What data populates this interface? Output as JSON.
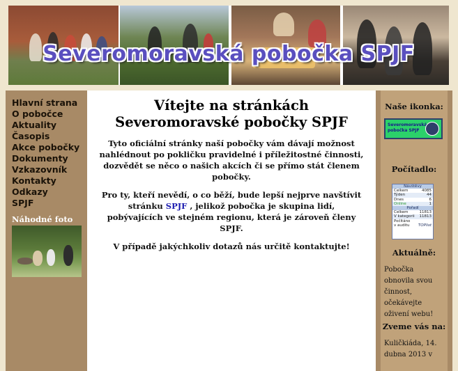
{
  "banner": {
    "title": "Severomoravská pobočka SPJF"
  },
  "nav": {
    "items": [
      {
        "label": "Hlavní strana"
      },
      {
        "label": "O pobočce"
      },
      {
        "label": "Aktuality"
      },
      {
        "label": "Časopis"
      },
      {
        "label": "Akce pobočky"
      },
      {
        "label": "Dokumenty"
      },
      {
        "label": "Vzkazovník"
      },
      {
        "label": "Kontakty"
      },
      {
        "label": "Odkazy"
      },
      {
        "label": "SPJF"
      }
    ],
    "random_photo_title": "Náhodné foto"
  },
  "main": {
    "heading": "Vítejte na stránkách Severomoravské pobočky SPJF",
    "p1": "Tyto oficiální stránky naší pobočky vám dávají možnost nahlédnout po pokličku pravidelné i příležitostné činnosti, dozvědět se něco o našich akcích či se přímo stát členem pobočky.",
    "p2_before": "Pro ty, kteří nevědí, o co běží, bude lepší nejprve navštívit stránku",
    "p2_link": "SPJF",
    "p2_after": ", jelikož pobočka je skupina lidí, pobývajících ve stejném regionu, která je zároveň členy SPJF.",
    "p3": "V případě jakýchkoliv dotazů nás určitě kontaktujte!"
  },
  "right": {
    "ikonka_title": "Naše ikonka:",
    "ikonka_text_1": "Severomoravská",
    "ikonka_text_2": "pobočka SPJF",
    "counter_title": "Počítadlo:",
    "counter": {
      "section1": "Návštěvy",
      "rows1": [
        {
          "label": "Celkem",
          "value": "4085"
        },
        {
          "label": "Týden",
          "value": "44"
        },
        {
          "label": "Dnes",
          "value": "6"
        },
        {
          "label": "Online",
          "value": "1"
        }
      ],
      "section2": "Pořadí",
      "rows2": [
        {
          "label": "Celkem",
          "value": "11813"
        },
        {
          "label": "V kategorii",
          "value": "11813"
        }
      ],
      "footer_1": "Počítáno",
      "footer_2": "v auditu",
      "footer_brand": "TOPlist"
    },
    "aktualne_title": "Aktuálně:",
    "aktualne_text": "Pobočka obnovila svou činnost, očekávejte oživení webu!",
    "zveme_title": "Zveme vás na:",
    "zveme_text": "Kuličkiáda, 14. dubna 2013 v"
  },
  "colors": {
    "page_bg": "#efe6cf",
    "sidebar": "#a88a66",
    "title_purple": "#5a4fbf",
    "link_blue": "#1c1cb0",
    "ikonka_green": "#2bd16a"
  }
}
